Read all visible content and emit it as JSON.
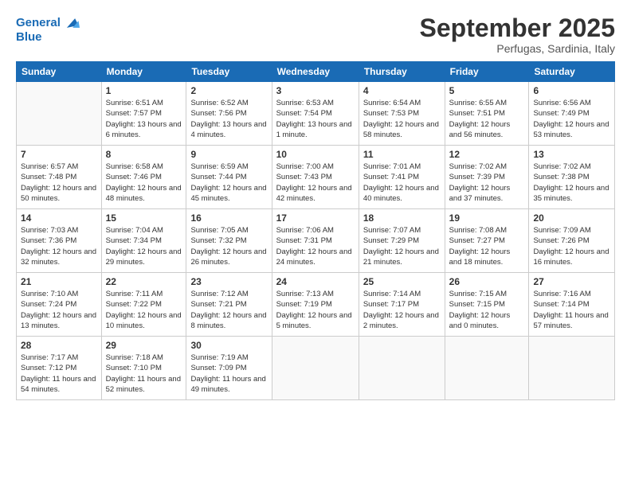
{
  "header": {
    "logo_line1": "General",
    "logo_line2": "Blue",
    "month": "September 2025",
    "location": "Perfugas, Sardinia, Italy"
  },
  "days_of_week": [
    "Sunday",
    "Monday",
    "Tuesday",
    "Wednesday",
    "Thursday",
    "Friday",
    "Saturday"
  ],
  "weeks": [
    [
      {
        "day": "",
        "sunrise": "",
        "sunset": "",
        "daylight": ""
      },
      {
        "day": "1",
        "sunrise": "Sunrise: 6:51 AM",
        "sunset": "Sunset: 7:57 PM",
        "daylight": "Daylight: 13 hours and 6 minutes."
      },
      {
        "day": "2",
        "sunrise": "Sunrise: 6:52 AM",
        "sunset": "Sunset: 7:56 PM",
        "daylight": "Daylight: 13 hours and 4 minutes."
      },
      {
        "day": "3",
        "sunrise": "Sunrise: 6:53 AM",
        "sunset": "Sunset: 7:54 PM",
        "daylight": "Daylight: 13 hours and 1 minute."
      },
      {
        "day": "4",
        "sunrise": "Sunrise: 6:54 AM",
        "sunset": "Sunset: 7:53 PM",
        "daylight": "Daylight: 12 hours and 58 minutes."
      },
      {
        "day": "5",
        "sunrise": "Sunrise: 6:55 AM",
        "sunset": "Sunset: 7:51 PM",
        "daylight": "Daylight: 12 hours and 56 minutes."
      },
      {
        "day": "6",
        "sunrise": "Sunrise: 6:56 AM",
        "sunset": "Sunset: 7:49 PM",
        "daylight": "Daylight: 12 hours and 53 minutes."
      }
    ],
    [
      {
        "day": "7",
        "sunrise": "Sunrise: 6:57 AM",
        "sunset": "Sunset: 7:48 PM",
        "daylight": "Daylight: 12 hours and 50 minutes."
      },
      {
        "day": "8",
        "sunrise": "Sunrise: 6:58 AM",
        "sunset": "Sunset: 7:46 PM",
        "daylight": "Daylight: 12 hours and 48 minutes."
      },
      {
        "day": "9",
        "sunrise": "Sunrise: 6:59 AM",
        "sunset": "Sunset: 7:44 PM",
        "daylight": "Daylight: 12 hours and 45 minutes."
      },
      {
        "day": "10",
        "sunrise": "Sunrise: 7:00 AM",
        "sunset": "Sunset: 7:43 PM",
        "daylight": "Daylight: 12 hours and 42 minutes."
      },
      {
        "day": "11",
        "sunrise": "Sunrise: 7:01 AM",
        "sunset": "Sunset: 7:41 PM",
        "daylight": "Daylight: 12 hours and 40 minutes."
      },
      {
        "day": "12",
        "sunrise": "Sunrise: 7:02 AM",
        "sunset": "Sunset: 7:39 PM",
        "daylight": "Daylight: 12 hours and 37 minutes."
      },
      {
        "day": "13",
        "sunrise": "Sunrise: 7:02 AM",
        "sunset": "Sunset: 7:38 PM",
        "daylight": "Daylight: 12 hours and 35 minutes."
      }
    ],
    [
      {
        "day": "14",
        "sunrise": "Sunrise: 7:03 AM",
        "sunset": "Sunset: 7:36 PM",
        "daylight": "Daylight: 12 hours and 32 minutes."
      },
      {
        "day": "15",
        "sunrise": "Sunrise: 7:04 AM",
        "sunset": "Sunset: 7:34 PM",
        "daylight": "Daylight: 12 hours and 29 minutes."
      },
      {
        "day": "16",
        "sunrise": "Sunrise: 7:05 AM",
        "sunset": "Sunset: 7:32 PM",
        "daylight": "Daylight: 12 hours and 26 minutes."
      },
      {
        "day": "17",
        "sunrise": "Sunrise: 7:06 AM",
        "sunset": "Sunset: 7:31 PM",
        "daylight": "Daylight: 12 hours and 24 minutes."
      },
      {
        "day": "18",
        "sunrise": "Sunrise: 7:07 AM",
        "sunset": "Sunset: 7:29 PM",
        "daylight": "Daylight: 12 hours and 21 minutes."
      },
      {
        "day": "19",
        "sunrise": "Sunrise: 7:08 AM",
        "sunset": "Sunset: 7:27 PM",
        "daylight": "Daylight: 12 hours and 18 minutes."
      },
      {
        "day": "20",
        "sunrise": "Sunrise: 7:09 AM",
        "sunset": "Sunset: 7:26 PM",
        "daylight": "Daylight: 12 hours and 16 minutes."
      }
    ],
    [
      {
        "day": "21",
        "sunrise": "Sunrise: 7:10 AM",
        "sunset": "Sunset: 7:24 PM",
        "daylight": "Daylight: 12 hours and 13 minutes."
      },
      {
        "day": "22",
        "sunrise": "Sunrise: 7:11 AM",
        "sunset": "Sunset: 7:22 PM",
        "daylight": "Daylight: 12 hours and 10 minutes."
      },
      {
        "day": "23",
        "sunrise": "Sunrise: 7:12 AM",
        "sunset": "Sunset: 7:21 PM",
        "daylight": "Daylight: 12 hours and 8 minutes."
      },
      {
        "day": "24",
        "sunrise": "Sunrise: 7:13 AM",
        "sunset": "Sunset: 7:19 PM",
        "daylight": "Daylight: 12 hours and 5 minutes."
      },
      {
        "day": "25",
        "sunrise": "Sunrise: 7:14 AM",
        "sunset": "Sunset: 7:17 PM",
        "daylight": "Daylight: 12 hours and 2 minutes."
      },
      {
        "day": "26",
        "sunrise": "Sunrise: 7:15 AM",
        "sunset": "Sunset: 7:15 PM",
        "daylight": "Daylight: 12 hours and 0 minutes."
      },
      {
        "day": "27",
        "sunrise": "Sunrise: 7:16 AM",
        "sunset": "Sunset: 7:14 PM",
        "daylight": "Daylight: 11 hours and 57 minutes."
      }
    ],
    [
      {
        "day": "28",
        "sunrise": "Sunrise: 7:17 AM",
        "sunset": "Sunset: 7:12 PM",
        "daylight": "Daylight: 11 hours and 54 minutes."
      },
      {
        "day": "29",
        "sunrise": "Sunrise: 7:18 AM",
        "sunset": "Sunset: 7:10 PM",
        "daylight": "Daylight: 11 hours and 52 minutes."
      },
      {
        "day": "30",
        "sunrise": "Sunrise: 7:19 AM",
        "sunset": "Sunset: 7:09 PM",
        "daylight": "Daylight: 11 hours and 49 minutes."
      },
      {
        "day": "",
        "sunrise": "",
        "sunset": "",
        "daylight": ""
      },
      {
        "day": "",
        "sunrise": "",
        "sunset": "",
        "daylight": ""
      },
      {
        "day": "",
        "sunrise": "",
        "sunset": "",
        "daylight": ""
      },
      {
        "day": "",
        "sunrise": "",
        "sunset": "",
        "daylight": ""
      }
    ]
  ]
}
